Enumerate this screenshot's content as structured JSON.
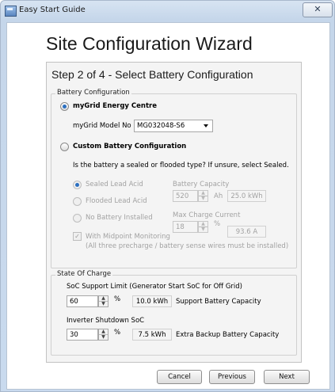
{
  "window": {
    "title": "Easy Start Guide",
    "close_glyph": "✕"
  },
  "wizard": {
    "title": "Site Configuration Wizard",
    "step_title": "Step 2 of 4 - Select Battery Configuration"
  },
  "battery_config": {
    "legend": "Battery Configuration",
    "mygrid": {
      "label": "myGrid Energy Centre",
      "selected": true,
      "model_label": "myGrid Model No",
      "model_value": "MG032048-S6"
    },
    "custom": {
      "label": "Custom Battery Configuration",
      "selected": false,
      "question": "Is the battery a sealed or flooded type? If unsure, select Sealed."
    },
    "types": [
      {
        "label": "Sealed Lead Acid",
        "selected": true
      },
      {
        "label": "Flooded Lead Acid",
        "selected": false
      },
      {
        "label": "No Battery Installed",
        "selected": false
      }
    ],
    "capacity": {
      "label": "Battery Capacity",
      "value": "520",
      "unit": "Ah",
      "readout": "25.0 kWh"
    },
    "max_charge": {
      "label": "Max Charge Current",
      "value": "18",
      "unit": "%",
      "readout": "93.6 A"
    },
    "midpoint": {
      "label": "With Midpoint Monitoring",
      "checked": true,
      "note": "(All three precharge / battery sense wires must be installed)"
    }
  },
  "soc": {
    "legend": "State Of Charge",
    "support": {
      "label": "SoC Support Limit (Generator Start SoC for Off Grid)",
      "value": "60",
      "unit": "%",
      "readout": "10.0 kWh",
      "note": "Support Battery Capacity"
    },
    "shutdown": {
      "label": "Inverter Shutdown SoC",
      "value": "30",
      "unit": "%",
      "readout": "7.5 kWh",
      "note": "Extra Backup Battery Capacity"
    }
  },
  "buttons": {
    "cancel": "Cancel",
    "previous": "Previous",
    "next": "Next"
  },
  "icons": {
    "app": "wizard-app-icon",
    "close": "close-icon",
    "dropdown": "chevron-down-icon",
    "spin_up": "spin-up-icon",
    "spin_down": "spin-down-icon"
  }
}
